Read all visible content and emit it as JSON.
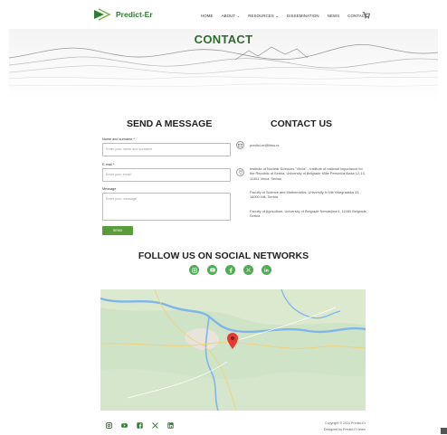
{
  "brand": {
    "name": "Predict-Er",
    "accent": "#2f7d32",
    "button_color": "#5a9c3a",
    "social_color": "#4caf50"
  },
  "nav": {
    "items": [
      {
        "label": "HOME"
      },
      {
        "label": "ABOUT ⌄"
      },
      {
        "label": "RESOURCES ⌄"
      },
      {
        "label": "DISSEMINATION"
      },
      {
        "label": "NEWS"
      },
      {
        "label": "CONTACT"
      }
    ],
    "cart_icon": "cart-icon"
  },
  "hero": {
    "title": "CONTACT"
  },
  "form": {
    "title": "SEND A MESSAGE",
    "name_label": "Name and surname *",
    "name_placeholder": "Enter your name and surname",
    "email_label": "E-mail *",
    "email_placeholder": "Enter your email",
    "message_label": "Message",
    "message_placeholder": "Enter your message",
    "submit_label": "SEND"
  },
  "contact": {
    "title": "CONTACT US",
    "email": "predict-er@ibiss.rs",
    "address_1": "Institute of Nuclear Sciences \"Vinča\" - Institute of national importance for the Republic of Serbia, University of Belgrade Mike Petrovića Alasa 12-14, 11351 Vinča, Serbia",
    "address_2": "Faculty of Science and Mathematics, University in Niš Višegradska 33, 18000 Niš, Serbia",
    "address_3": "Faculty of Agriculture, University of Belgrade Nemanjina 6, 11080 Belgrade, Serbia"
  },
  "follow": {
    "title": "FOLLOW US ON SOCIAL NETWORKS",
    "icons": [
      "instagram-icon",
      "youtube-icon",
      "facebook-icon",
      "x-icon",
      "linkedin-icon"
    ]
  },
  "footer": {
    "copyright": "Copyright © 2024 Predict-Er",
    "credit": "Designed by Predict-Er team"
  }
}
